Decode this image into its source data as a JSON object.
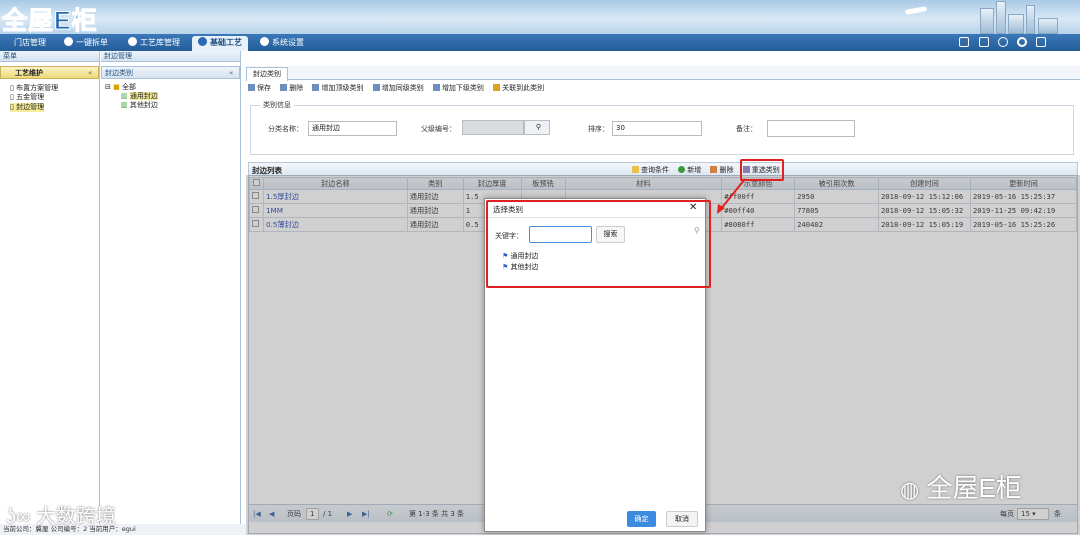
{
  "app": {
    "logo": "全屋E柜"
  },
  "nav": {
    "tabs": [
      {
        "label": "门店管理"
      },
      {
        "label": "一键拆单"
      },
      {
        "label": "工艺库管理"
      },
      {
        "label": "基础工艺"
      },
      {
        "label": "系统设置"
      }
    ],
    "tool_icons": [
      "monitor-icon",
      "calendar-icon",
      "user-icon",
      "gear-icon",
      "exit-icon"
    ]
  },
  "left": {
    "header": "菜单",
    "section": "工艺维护",
    "items": [
      {
        "label": "布置方案管理"
      },
      {
        "label": "五金管理"
      },
      {
        "label": "封边管理"
      }
    ]
  },
  "tree": {
    "header": "封边类别",
    "root": "全部",
    "children": [
      {
        "label": "通用封边"
      },
      {
        "label": "其他封边"
      }
    ]
  },
  "breadcrumb": "封边管理",
  "tab": "封边类别",
  "toolbar": {
    "items": [
      {
        "label": "保存"
      },
      {
        "label": "删除"
      },
      {
        "label": "增加顶级类别"
      },
      {
        "label": "增加同级类别"
      },
      {
        "label": "增加下级类别"
      },
      {
        "label": "关联到此类别"
      }
    ]
  },
  "form": {
    "legend": "类别信息",
    "name_label": "分类名称：",
    "name_value": "通用封边",
    "parent_label": "父级编号：",
    "sort_label": "排序：",
    "sort_value": "30",
    "remark_label": "备注："
  },
  "grid": {
    "title": "封边列表",
    "actions": [
      {
        "label": "查询条件"
      },
      {
        "label": "新增"
      },
      {
        "label": "删除"
      },
      {
        "label": "重选类别"
      }
    ],
    "columns": [
      "封边名称",
      "类别",
      "封边厚度",
      "板预铣",
      "材料",
      "示意颜色",
      "被引用次数",
      "创建时间",
      "更新时间"
    ],
    "rows": [
      [
        "1.5厚封边",
        "通用封边",
        "1.5",
        "",
        "",
        "#ff00ff",
        "2950",
        "2018-09-12 15:12:06",
        "2019-05-16 15:25:37"
      ],
      [
        "1MM",
        "通用封边",
        "1",
        "",
        "",
        "#00ff40",
        "77805",
        "2018-09-12 15:05:32",
        "2019-11-25 09:42:19"
      ],
      [
        "0.5薄封边",
        "通用封边",
        "0.5",
        "",
        "",
        "#8080ff",
        "240402",
        "2018-09-12 15:05:19",
        "2019-05-16 15:25:26"
      ]
    ],
    "pager": {
      "page_label": "页码",
      "page": "1",
      "total_pages": "/ 1",
      "summary": "第 1-3 条  共 3 条",
      "per_page_label": "每页",
      "per_page": "15",
      "unit": "条"
    }
  },
  "dialog": {
    "title": "选择类别",
    "keyword_label": "关键字：",
    "keyword_value": "",
    "search_label": "搜索",
    "items": [
      {
        "label": "通用封边"
      },
      {
        "label": "其他封边"
      }
    ],
    "ok_label": "确定",
    "cancel_label": "取消"
  },
  "status": {
    "text": "当前公司：冀厘  公司编号：2  当前用户：egui"
  },
  "watermarks": {
    "left": "大数跨境",
    "right": "全屋E柜"
  }
}
